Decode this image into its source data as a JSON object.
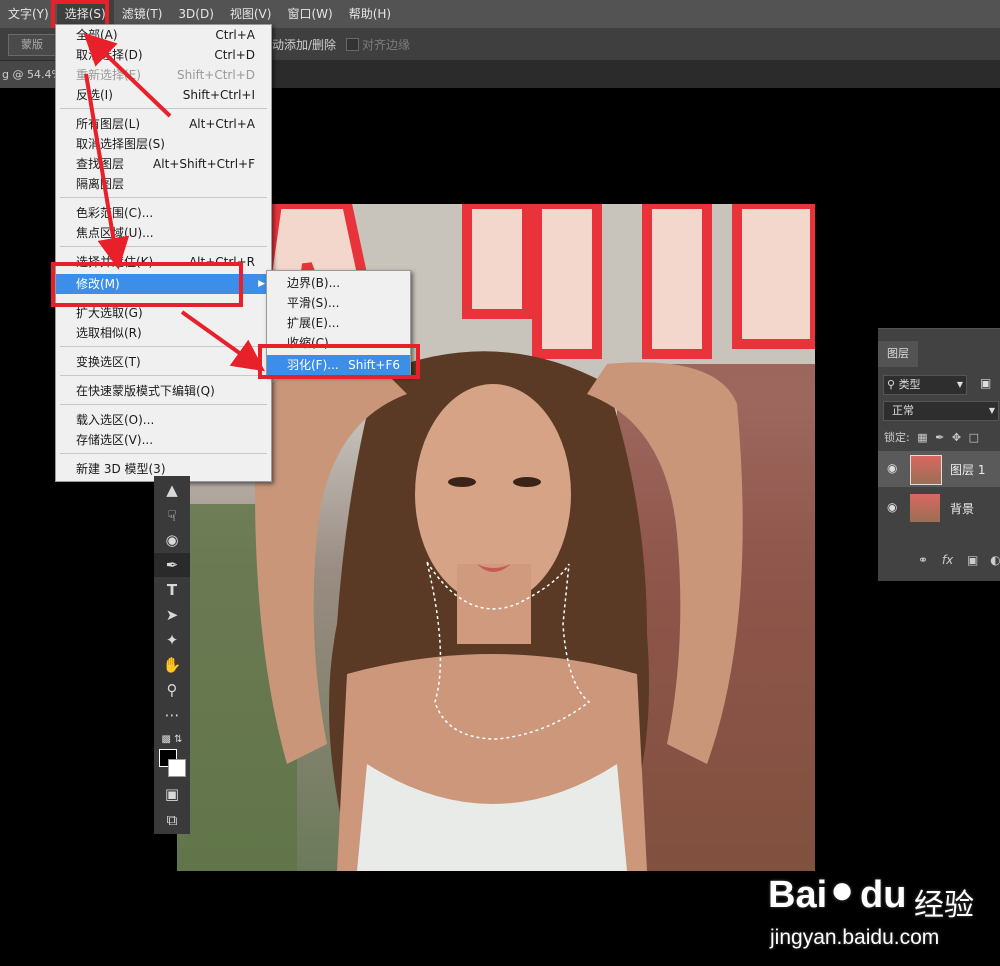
{
  "menubar": {
    "items": [
      "文字(Y)",
      "选择(S)",
      "滤镜(T)",
      "3D(D)",
      "视图(V)",
      "窗口(W)",
      "帮助(H)"
    ]
  },
  "options": {
    "mask_label": "蒙版",
    "auto_add_label": "动添加/删除",
    "align_edges_label": "对齐边缘"
  },
  "doc": {
    "tab_label": "g @ 54.4% ("
  },
  "select_menu": {
    "items": [
      {
        "label": "全部(A)",
        "shortcut": "Ctrl+A"
      },
      {
        "label": "取消选择(D)",
        "shortcut": "Ctrl+D"
      },
      {
        "label": "重新选择(E)",
        "shortcut": "Shift+Ctrl+D"
      },
      {
        "label": "反选(I)",
        "shortcut": "Shift+Ctrl+I"
      },
      {
        "label": "所有图层(L)",
        "shortcut": "Alt+Ctrl+A"
      },
      {
        "label": "取消选择图层(S)",
        "shortcut": ""
      },
      {
        "label": "查找图层",
        "shortcut": "Alt+Shift+Ctrl+F"
      },
      {
        "label": "隔离图层",
        "shortcut": ""
      },
      {
        "label": "色彩范围(C)...",
        "shortcut": ""
      },
      {
        "label": "焦点区域(U)...",
        "shortcut": ""
      },
      {
        "label": "选择并遮住(K)...",
        "shortcut": "Alt+Ctrl+R"
      },
      {
        "label": "修改(M)",
        "shortcut": ""
      },
      {
        "label": "扩大选取(G)",
        "shortcut": ""
      },
      {
        "label": "选取相似(R)",
        "shortcut": ""
      },
      {
        "label": "变换选区(T)",
        "shortcut": ""
      },
      {
        "label": "在快速蒙版模式下编辑(Q)",
        "shortcut": ""
      },
      {
        "label": "载入选区(O)...",
        "shortcut": ""
      },
      {
        "label": "存储选区(V)...",
        "shortcut": ""
      },
      {
        "label": "新建 3D 模型(3)",
        "shortcut": ""
      }
    ]
  },
  "modify_submenu": {
    "items": [
      {
        "label": "边界(B)...",
        "shortcut": ""
      },
      {
        "label": "平滑(S)...",
        "shortcut": ""
      },
      {
        "label": "扩展(E)...",
        "shortcut": ""
      },
      {
        "label": "收缩(C)...",
        "shortcut": ""
      },
      {
        "label": "羽化(F)...",
        "shortcut": "Shift+F6"
      }
    ]
  },
  "layers_panel": {
    "tab": "图层",
    "filter_label": "类型",
    "blend_mode": "正常",
    "lock_label": "锁定:",
    "layers": [
      {
        "name": "图层 1",
        "selected": true
      },
      {
        "name": "背景",
        "selected": false
      }
    ]
  },
  "watermark": {
    "brand": "Bai",
    "brand2": "du",
    "suffix": "经验",
    "url": "jingyan.baidu.com"
  },
  "colors": {
    "highlight": "#3c8ee8",
    "annotation": "#e8202a",
    "menubar": "#535353"
  }
}
